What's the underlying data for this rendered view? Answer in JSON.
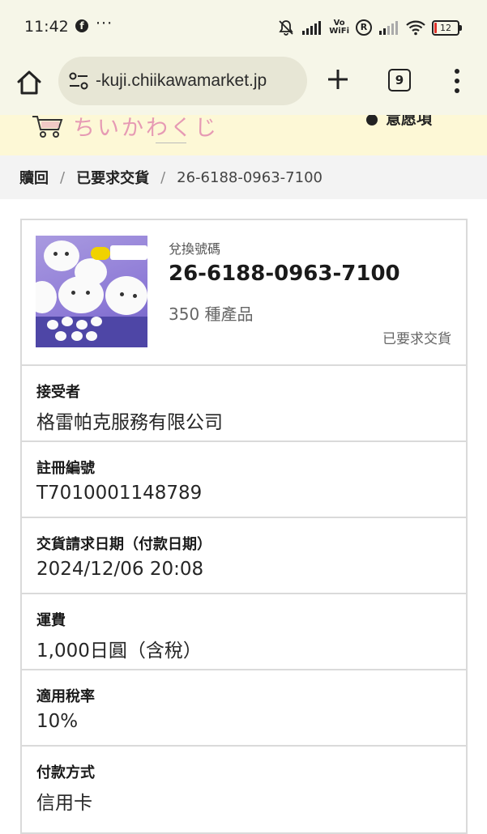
{
  "status_bar": {
    "time": "11:42",
    "volte": "Vo\nWiFi",
    "battery": "12",
    "icons": [
      "facebook-icon",
      "more-dots-icon",
      "mute-icon",
      "signal-icon",
      "volte-icon",
      "registered-icon",
      "signal-icon",
      "wifi-icon",
      "battery-icon"
    ]
  },
  "browser": {
    "url": "-kuji.chiikawamarket.jp",
    "tab_count": "9"
  },
  "site": {
    "logo_text": "ちいかわくじ",
    "header_link": "意愿項"
  },
  "breadcrumb": {
    "items": [
      "贖回",
      "已要求交貨"
    ],
    "current": "26-6188-0963-7100",
    "separator": "/"
  },
  "product": {
    "label": "兌換號碼",
    "code": "26-6188-0963-7100",
    "count": "350 種產品",
    "status": "已要求交貨"
  },
  "details": [
    {
      "label": "接受者",
      "value": "格雷帕克服務有限公司"
    },
    {
      "label": "註冊編號",
      "value": "T7010001148789"
    },
    {
      "label": "交貨請求日期（付款日期）",
      "value": "2024/12/06 20:08"
    },
    {
      "label": "運費",
      "value": "1,000日圓（含稅）"
    },
    {
      "label": "適用稅率",
      "value": "10%"
    },
    {
      "label": "付款方式",
      "value": "信用卡"
    }
  ],
  "colors": {
    "chrome_bg": "#f6f6e8",
    "site_header_bg": "#fdf8d6",
    "logo_pink": "#e69ab4",
    "battery_low": "#e0312a"
  }
}
